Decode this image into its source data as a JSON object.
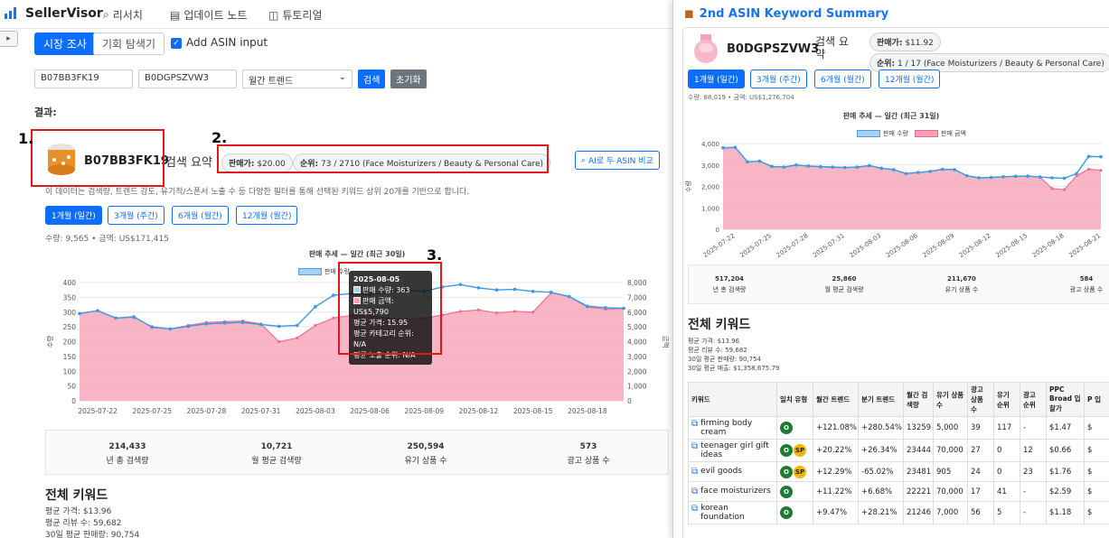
{
  "app": {
    "name": "SellerVisor",
    "nav": [
      {
        "icon": "search-icon",
        "label": "리서치"
      },
      {
        "icon": "notes-icon",
        "label": "업데이트 노트"
      },
      {
        "icon": "book-icon",
        "label": "튜토리얼"
      }
    ]
  },
  "tabs": {
    "market": "시장 조사",
    "opportunity": "기회 탐색기"
  },
  "add_asin_label": "Add ASIN input",
  "form": {
    "asin1": "B07BB3FK19",
    "asin2": "B0DGPSZVW3",
    "period": "월간 트렌드",
    "search_btn": "검색",
    "reset_btn": "초기화"
  },
  "results_label": "결과:",
  "markers": [
    "1.",
    "2.",
    "3."
  ],
  "main": {
    "asin": "B07BB3FK19",
    "summary_label": "검색 요약",
    "price_label": "판매가:",
    "price": "$20.00",
    "rank_label": "순위:",
    "rank": "73 / 2710 (Face Moisturizers / Beauty & Personal Care)",
    "ai_button": "AI로 두 ASIN 비교",
    "desc": "이 데이터는 검색량, 트렌드 강도, 유기적/스폰서 노출 수 등 다양한 필터를 통해 선택된 키워드 상위 20개를 기반으로 합니다.",
    "period_tabs": [
      "1개월 (일간)",
      "3개월 (주간)",
      "6개월 (월간)",
      "12개월 (월간)"
    ],
    "qty_line": "수량: 9,565  •  금액: US$171,415",
    "stats": [
      {
        "v": "214,433",
        "l": "년 총 검색량"
      },
      {
        "v": "10,721",
        "l": "월 평균 검색량"
      },
      {
        "v": "250,594",
        "l": "유기 상품 수"
      },
      {
        "v": "573",
        "l": "광고 상품 수"
      }
    ],
    "section": "전체 키워드",
    "avg": [
      "평균 가격: $13.96",
      "평균 리뷰 수: 59,682",
      "30일 평균 판매량: 90,754"
    ],
    "tooltip": {
      "date": "2025-08-05",
      "qty": "판매 수량: 363",
      "amt": "판매 금액: US$5,790",
      "price": "평균 가격: 15.95",
      "cat": "평균 카테고리 순위: N/A",
      "exp": "평균 노출 순위: N/A"
    }
  },
  "panel": {
    "title": "2nd ASIN Keyword Summary",
    "asin": "B0DGPSZVW3",
    "summary_label": "검색 요약",
    "price_label": "판매가:",
    "price": "$11.92",
    "rank_label": "순위:",
    "rank": "1 / 17 (Face Moisturizers / Beauty & Personal Care)",
    "period_tabs": [
      "1개월 (일간)",
      "3개월 (주간)",
      "6개월 (월간)",
      "12개월 (월간)"
    ],
    "qty_line": "수량: 88,019  •  금액: US$1,276,704",
    "stats": [
      {
        "v": "517,204",
        "l": "년 총 검색량"
      },
      {
        "v": "25,860",
        "l": "월 평균 검색량"
      },
      {
        "v": "211,670",
        "l": "유기 상품 수"
      },
      {
        "v": "584",
        "l": "광고 상품 수"
      }
    ],
    "section": "전체 키워드",
    "avg": [
      "평균 가격: $13.96",
      "평균 리뷰 수: 59,682",
      "30일 평균 판매량: 90,754",
      "30일 평균 매출: $1,358,675.79"
    ],
    "headers": [
      "키워드",
      "일치 유형",
      "월간 트렌드",
      "분기 트렌드",
      "월간 검색량",
      "유기 상품 수",
      "광고 상품 수",
      "유기 순위",
      "광고 순위",
      "PPC Broad 입찰가",
      "P 입"
    ],
    "rows": [
      {
        "kw": "firming body cream",
        "badges": [
          "O"
        ],
        "m": "+121.08%",
        "q": "+280.54%",
        "sv": "13259",
        "org": "5,000",
        "ad": "39",
        "or": "117",
        "ar": "-",
        "ppc": "$1.47",
        "p": "$"
      },
      {
        "kw": "teenager girl gift ideas",
        "badges": [
          "O",
          "SP"
        ],
        "m": "+20.22%",
        "q": "+26.34%",
        "sv": "23444",
        "org": "70,000",
        "ad": "27",
        "or": "0",
        "ar": "12",
        "ppc": "$0.66",
        "p": "$"
      },
      {
        "kw": "evil goods",
        "badges": [
          "O",
          "SP"
        ],
        "m": "+12.29%",
        "q": "-65.02%",
        "sv": "23481",
        "org": "905",
        "ad": "24",
        "or": "0",
        "ar": "23",
        "ppc": "$1.76",
        "p": "$"
      },
      {
        "kw": "face moisturizers",
        "badges": [
          "O"
        ],
        "m": "+11.22%",
        "q": "+6.68%",
        "sv": "22221",
        "org": "70,000",
        "ad": "17",
        "or": "41",
        "ar": "-",
        "ppc": "$2.59",
        "p": "$"
      },
      {
        "kw": "korean foundation",
        "badges": [
          "O"
        ],
        "m": "+9.47%",
        "q": "+28.21%",
        "sv": "21246",
        "org": "7,000",
        "ad": "56",
        "or": "5",
        "ar": "-",
        "ppc": "$1.18",
        "p": "$"
      }
    ]
  },
  "chart_data": [
    {
      "type": "line",
      "title": "판매 추세 — 일간 (최근 30일)",
      "legend": [
        "판매 수량",
        "판매 금액"
      ],
      "x": [
        "2025-07-21",
        "2025-07-22",
        "2025-07-23",
        "2025-07-24",
        "2025-07-25",
        "2025-07-26",
        "2025-07-27",
        "2025-07-28",
        "2025-07-29",
        "2025-07-30",
        "2025-07-31",
        "2025-08-01",
        "2025-08-02",
        "2025-08-03",
        "2025-08-04",
        "2025-08-05",
        "2025-08-06",
        "2025-08-07",
        "2025-08-08",
        "2025-08-09",
        "2025-08-10",
        "2025-08-11",
        "2025-08-12",
        "2025-08-13",
        "2025-08-14",
        "2025-08-15",
        "2025-08-16",
        "2025-08-17",
        "2025-08-18",
        "2025-08-19",
        "2025-08-20"
      ],
      "xticks": [
        "2025-07-22",
        "2025-07-25",
        "2025-07-28",
        "2025-07-31",
        "2025-08-03",
        "2025-08-06",
        "2025-08-09",
        "2025-08-12",
        "2025-08-15",
        "2025-08-18"
      ],
      "ylabel": "수량",
      "y2label": "금액",
      "ylim": [
        0,
        400
      ],
      "y2lim": [
        0,
        8000
      ],
      "series": [
        {
          "name": "판매 수량",
          "values": [
            295,
            305,
            280,
            283,
            250,
            243,
            252,
            260,
            263,
            265,
            258,
            252,
            255,
            318,
            357,
            363,
            360,
            365,
            373,
            370,
            385,
            393,
            382,
            375,
            377,
            370,
            367,
            353,
            320,
            315,
            313
          ]
        },
        {
          "name": "판매 금액",
          "values": [
            5900,
            6100,
            5600,
            5700,
            4950,
            4850,
            5100,
            5300,
            5350,
            5400,
            5200,
            4000,
            4250,
            5100,
            5600,
            5790,
            5750,
            5600,
            5500,
            5600,
            5800,
            6050,
            6150,
            5950,
            6050,
            6000,
            7300,
            7050,
            6350,
            6200,
            6250
          ]
        }
      ]
    },
    {
      "type": "line",
      "title": "판매 추세 — 일간 (최근 31일)",
      "legend": [
        "판매 수량",
        "판매 금액"
      ],
      "x": [
        "2025-07-21",
        "2025-07-22",
        "2025-07-23",
        "2025-07-24",
        "2025-07-25",
        "2025-07-26",
        "2025-07-27",
        "2025-07-28",
        "2025-07-29",
        "2025-07-30",
        "2025-07-31",
        "2025-08-01",
        "2025-08-02",
        "2025-08-03",
        "2025-08-04",
        "2025-08-05",
        "2025-08-06",
        "2025-08-07",
        "2025-08-08",
        "2025-08-09",
        "2025-08-10",
        "2025-08-11",
        "2025-08-12",
        "2025-08-13",
        "2025-08-14",
        "2025-08-15",
        "2025-08-16",
        "2025-08-17",
        "2025-08-18",
        "2025-08-19",
        "2025-08-20",
        "2025-08-21"
      ],
      "xticks": [
        "2025-07-22",
        "2025-07-25",
        "2025-07-28",
        "2025-07-31",
        "2025-08-03",
        "2025-08-06",
        "2025-08-09",
        "2025-08-12",
        "2025-08-15",
        "2025-08-18",
        "2025-08-21"
      ],
      "ylabel": "수량",
      "ylim": [
        0,
        4000
      ],
      "series": [
        {
          "name": "판매 수량",
          "values": [
            3800,
            3820,
            3150,
            3180,
            2930,
            2900,
            3000,
            2950,
            2920,
            2900,
            2880,
            2900,
            2970,
            2850,
            2780,
            2600,
            2650,
            2700,
            2800,
            2780,
            2500,
            2400,
            2420,
            2450,
            2470,
            2480,
            2440,
            2400,
            2380,
            2600,
            3400,
            3380
          ]
        },
        {
          "name": "판매 금액",
          "values": [
            3800,
            3820,
            3150,
            3180,
            2930,
            2900,
            3000,
            2950,
            2920,
            2900,
            2880,
            2900,
            2970,
            2850,
            2780,
            2600,
            2650,
            2700,
            2800,
            2780,
            2500,
            2400,
            2420,
            2450,
            2470,
            2480,
            2440,
            1900,
            1850,
            2500,
            2800,
            2750
          ]
        }
      ]
    }
  ]
}
